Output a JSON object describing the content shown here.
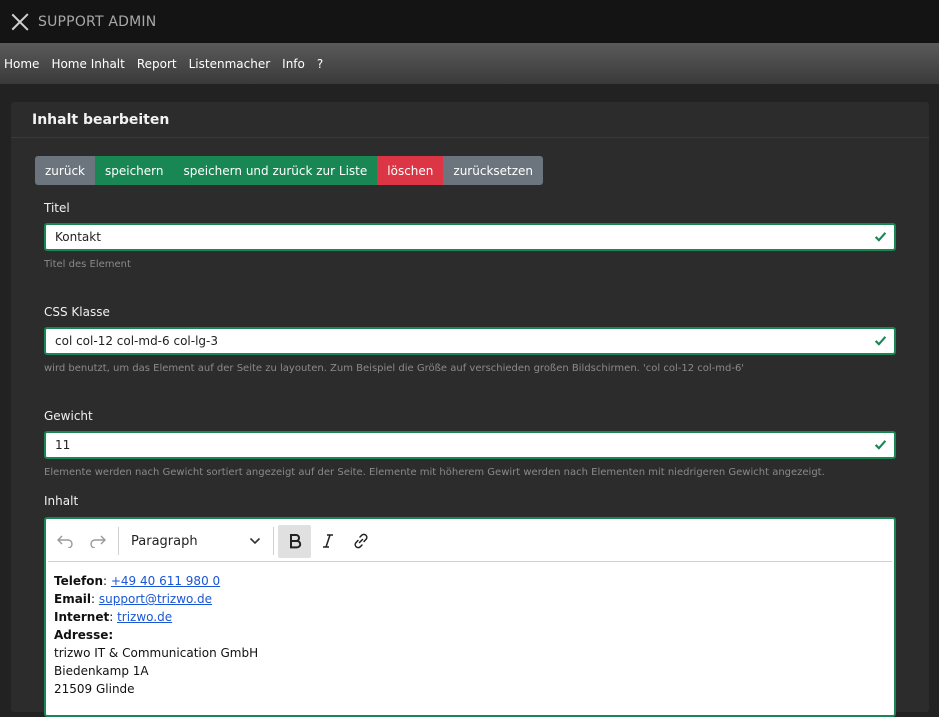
{
  "app": {
    "title": "SUPPORT ADMIN"
  },
  "nav": {
    "items": [
      "Home",
      "Home Inhalt",
      "Report",
      "Listenmacher",
      "Info",
      "?"
    ]
  },
  "card": {
    "title": "Inhalt bearbeiten"
  },
  "actions": {
    "back": "zurück",
    "save": "speichern",
    "save_back": "speichern und zurück zur Liste",
    "delete": "löschen",
    "reset": "zurücksetzen"
  },
  "fields": {
    "titel": {
      "label": "Titel",
      "value": "Kontakt",
      "help": "Titel des Element"
    },
    "css": {
      "label": "CSS Klasse",
      "value": "col col-12 col-md-6 col-lg-3",
      "help": "wird benutzt, um das Element auf der Seite zu layouten. Zum Beispiel die Größe auf verschieden großen Bildschirmen. 'col col-12 col-md-6'"
    },
    "gewicht": {
      "label": "Gewicht",
      "value": "11",
      "help": "Elemente werden nach Gewicht sortiert angezeigt auf der Seite. Elemente mit höherem Gewirt werden nach Elementen mit niedrigeren Gewicht angezeigt."
    },
    "inhalt": {
      "label": "Inhalt"
    }
  },
  "editor": {
    "block_format": "Paragraph",
    "lines": {
      "telefon_label": "Telefon",
      "telefon_value": "+49 40 611 980 0",
      "email_label": "Email",
      "email_value": "support@trizwo.de",
      "internet_label": "Internet",
      "internet_value": "trizwo.de",
      "adresse_label": "Adresse:",
      "address_1": "trizwo IT & Communication GmbH",
      "address_2": "Biedenkamp 1A",
      "address_3": "21509 Glinde"
    }
  },
  "colors": {
    "accent": "#198754",
    "danger": "#dc3545",
    "secondary": "#6c757d"
  }
}
